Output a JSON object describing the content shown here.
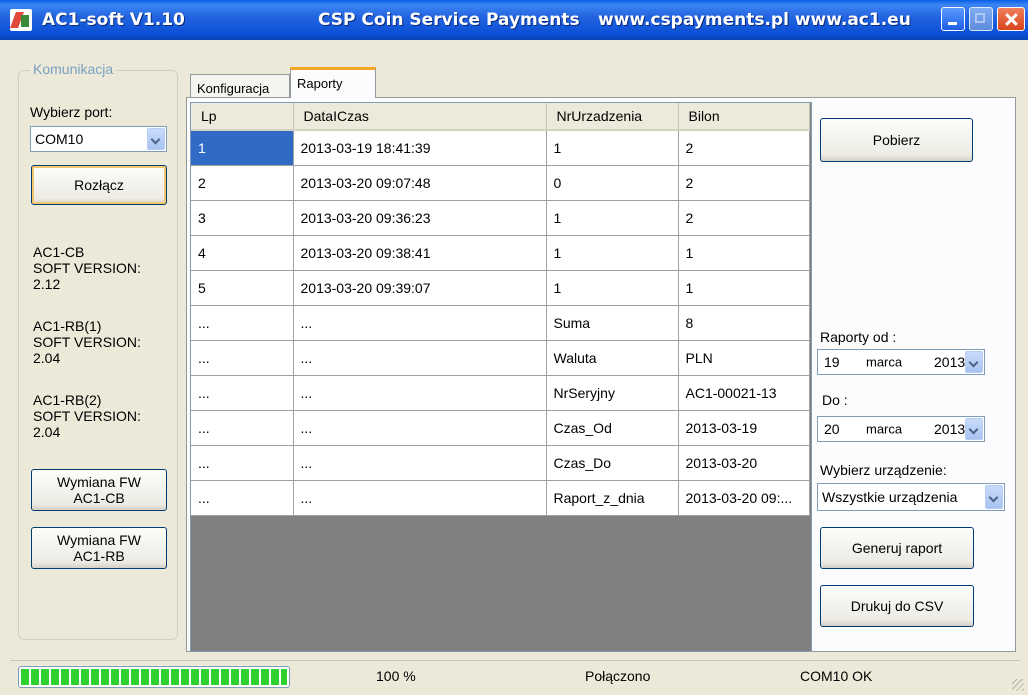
{
  "window": {
    "title_app": "AC1-soft V1.10",
    "title_company": "CSP Coin Service Payments",
    "title_urls": "www.cspayments.pl www.ac1.eu"
  },
  "sidebar": {
    "group_title": "Komunikacja",
    "port_label": "Wybierz port:",
    "port_value": "COM10",
    "disconnect_label": "Rozłącz",
    "devices": [
      {
        "name": "AC1-CB",
        "version_label": "SOFT VERSION:",
        "version": "2.12"
      },
      {
        "name": "AC1-RB(1)",
        "version_label": "SOFT VERSION:",
        "version": "2.04"
      },
      {
        "name": "AC1-RB(2)",
        "version_label": "SOFT VERSION:",
        "version": "2.04"
      }
    ],
    "fw_cb_label_1": "Wymiana FW",
    "fw_cb_label_2": "AC1-CB",
    "fw_rb_label_1": "Wymiana FW",
    "fw_rb_label_2": "AC1-RB"
  },
  "tabs": [
    {
      "label": "Konfiguracja",
      "active": false
    },
    {
      "label": "Raporty",
      "active": true
    }
  ],
  "grid": {
    "columns": [
      "Lp",
      "DataICzas",
      "NrUrzadzenia",
      "Bilon"
    ],
    "rows": [
      [
        "1",
        "2013-03-19 18:41:39",
        "1",
        "2"
      ],
      [
        "2",
        "2013-03-20 09:07:48",
        "0",
        "2"
      ],
      [
        "3",
        "2013-03-20 09:36:23",
        "1",
        "2"
      ],
      [
        "4",
        "2013-03-20 09:38:41",
        "1",
        "1"
      ],
      [
        "5",
        "2013-03-20 09:39:07",
        "1",
        "1"
      ],
      [
        "...",
        "...",
        "Suma",
        "8"
      ],
      [
        "...",
        "...",
        "Waluta",
        "PLN"
      ],
      [
        "...",
        "...",
        "NrSeryjny",
        "AC1-00021-13"
      ],
      [
        "...",
        "...",
        "Czas_Od",
        "2013-03-19"
      ],
      [
        "...",
        "...",
        "Czas_Do",
        "2013-03-20"
      ],
      [
        "...",
        "...",
        "Raport_z_dnia",
        "2013-03-20 09:..."
      ]
    ]
  },
  "right_panel": {
    "fetch_label": "Pobierz",
    "reports_from_label": "Raporty od :",
    "from_date": {
      "day": "19",
      "month": "marca",
      "year": "2013"
    },
    "to_label": "Do :",
    "to_date": {
      "day": "20",
      "month": "marca",
      "year": "2013"
    },
    "device_label": "Wybierz urządzenie:",
    "device_value": "Wszystkie urządzenia",
    "generate_label": "Generuj raport",
    "csv_label": "Drukuj do CSV"
  },
  "statusbar": {
    "progress": 1.0,
    "percent_text": "100 %",
    "connection_text": "Połączono",
    "port_status_text": "COM10 OK"
  },
  "colors": {
    "titlebar": "#2465e0",
    "selection": "#316ac5",
    "progress": "#2fd12f",
    "group_title": "#7ba0c4"
  }
}
